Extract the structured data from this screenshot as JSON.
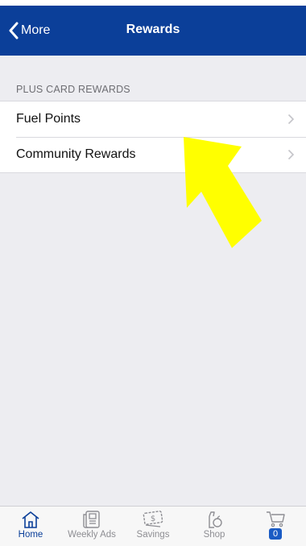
{
  "navbar": {
    "back_label": "More",
    "title": "Rewards",
    "background_color": "#0b3f99"
  },
  "section": {
    "header": "PLUS CARD REWARDS",
    "items": [
      {
        "label": "Fuel Points",
        "icon": "chevron-right-icon"
      },
      {
        "label": "Community Rewards",
        "icon": "chevron-right-icon"
      }
    ]
  },
  "annotation": {
    "icon": "arrow-icon",
    "color": "#ffff00"
  },
  "tabbar": {
    "active_color": "#0b3f99",
    "tabs": [
      {
        "label": "Home",
        "icon": "home-icon",
        "active": true
      },
      {
        "label": "Weekly Ads",
        "icon": "weekly-ad-icon",
        "active": false
      },
      {
        "label": "Savings",
        "icon": "coupon-icon",
        "active": false
      },
      {
        "label": "Shop",
        "icon": "shop-bag-icon",
        "active": false
      },
      {
        "label": "",
        "icon": "cart-icon",
        "badge": "0",
        "active": false
      }
    ]
  }
}
